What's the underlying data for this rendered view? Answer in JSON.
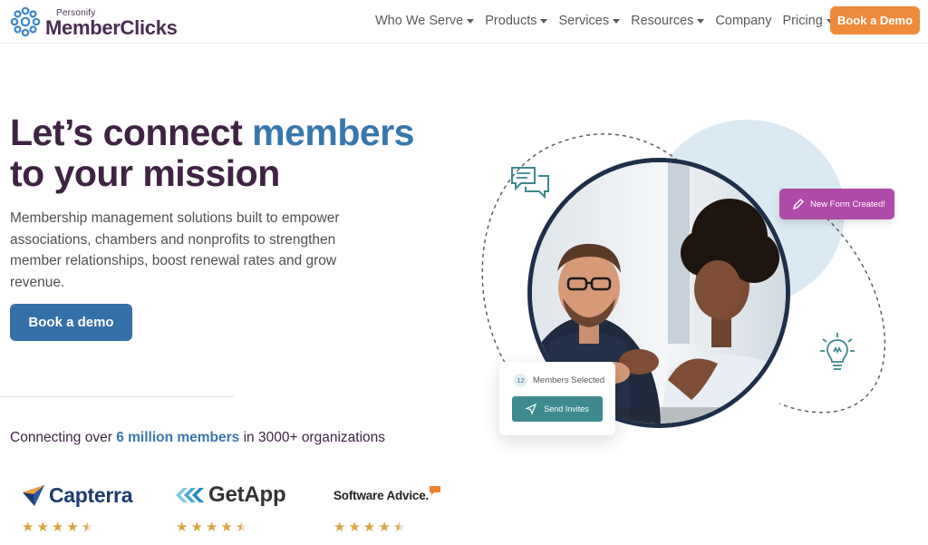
{
  "header": {
    "logo_small": "Personify",
    "logo_big": "MemberClicks",
    "nav": [
      {
        "label": "Who We Serve",
        "has_dropdown": true
      },
      {
        "label": "Products",
        "has_dropdown": true
      },
      {
        "label": "Services",
        "has_dropdown": true
      },
      {
        "label": "Resources",
        "has_dropdown": true
      },
      {
        "label": "Company",
        "has_dropdown": false
      },
      {
        "label": "Pricing",
        "has_dropdown": true
      }
    ],
    "cta_label": "Book a Demo"
  },
  "hero": {
    "title_part1": "Let’s connect ",
    "title_accent": "members",
    "title_part2": "to your mission",
    "subtitle": "Membership management solutions built to empower associations, chambers and nonprofits to strengthen member relationships, boost renewal rates and grow revenue.",
    "cta_label": "Book a demo"
  },
  "stats": {
    "prefix": "Connecting over ",
    "highlight": "6 million members",
    "suffix": " in 3000+ organizations"
  },
  "reviews": [
    {
      "name": "Capterra",
      "rating": 4.5
    },
    {
      "name": "GetApp",
      "rating": 4.5
    },
    {
      "name": "Software Advice",
      "name_suffix": ".",
      "rating": 4.5
    }
  ],
  "graphic": {
    "form_badge": "New Form Created!",
    "members_count": "12",
    "members_label": "Members Selected",
    "send_label": "Send Invites"
  },
  "colors": {
    "brand_purple": "#3e2342",
    "accent_blue": "#3877ad",
    "cta_orange": "#ef8a3a",
    "badge_magenta": "#b04aa8",
    "teal": "#3d8a8f",
    "star_gold": "#d9a441"
  }
}
